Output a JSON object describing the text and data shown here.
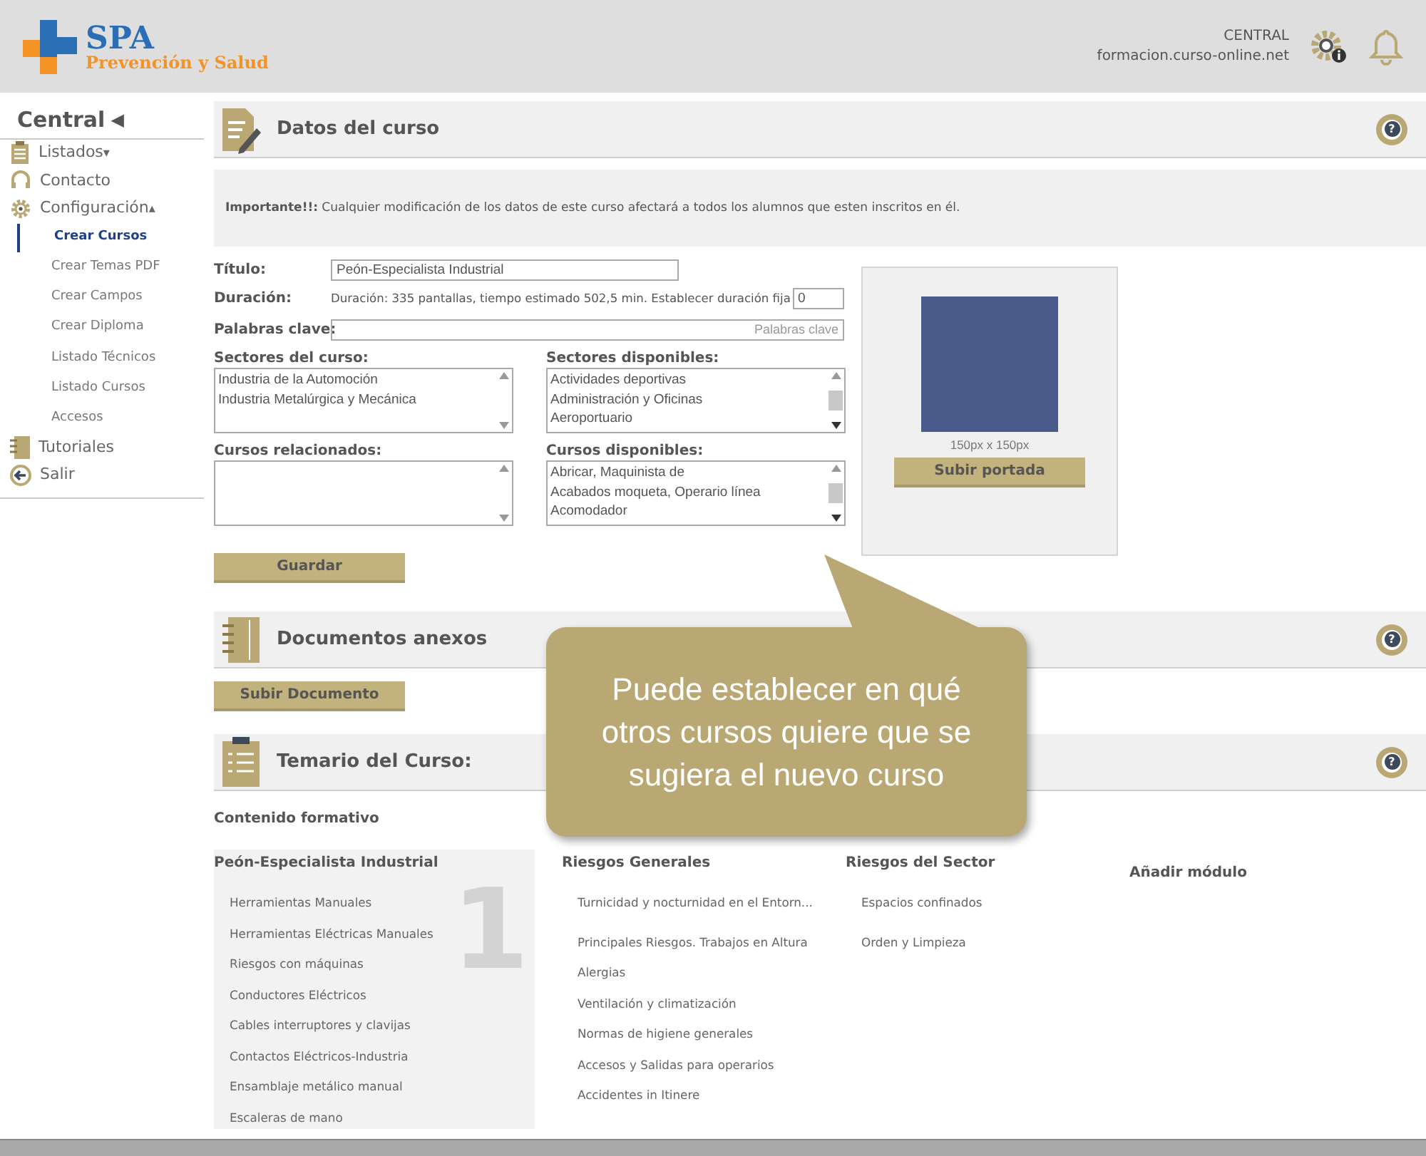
{
  "header": {
    "logo_title": "SPA",
    "logo_subtitle": "Prevención y Salud",
    "center": "CENTRAL",
    "domain": "formacion.curso-online.net"
  },
  "sidebar": {
    "title": "Central",
    "title_caret": "◀",
    "items": [
      {
        "label": "Listados",
        "caret": "▾"
      },
      {
        "label": "Contacto"
      },
      {
        "label": "Configuración",
        "caret": "▴",
        "children": [
          {
            "label": "Crear Cursos",
            "selected": true
          },
          {
            "label": "Crear Temas PDF",
            "selected": false
          },
          {
            "label": "Crear Campos",
            "selected": false
          },
          {
            "label": "Crear Diploma",
            "selected": false
          },
          {
            "label": "Listado Técnicos",
            "selected": false
          },
          {
            "label": "Listado Cursos",
            "selected": false
          },
          {
            "label": "Accesos",
            "selected": false
          }
        ]
      },
      {
        "label": "Tutoriales"
      },
      {
        "label": "Salir"
      }
    ]
  },
  "datos": {
    "title": "Datos del curso",
    "help": "?",
    "notice_bold": "Importante!!:",
    "notice": "Cualquier modificación de los datos de este curso afectará a todos los alumnos que esten inscritos en él.",
    "titulo_label": "Título:",
    "titulo_value": "Peón-Especialista Industrial",
    "duracion_label": "Duración:",
    "duracion_text": "Duración: 335 pantallas, tiempo estimado 502,5 min. Establecer duración fija",
    "duracion_value": "0",
    "keywords_label": "Palabras clave:",
    "keywords_placeholder": "Palabras clave",
    "lists": [
      {
        "label": "Sectores del curso:",
        "items": [
          "Industria de la Automoción",
          "Industria Metalúrgica y Mecánica"
        ]
      },
      {
        "label": "Sectores disponibles:",
        "items": [
          "Actividades deportivas",
          "Administración y Oficinas",
          "Aeroportuario"
        ]
      },
      {
        "label": "Cursos relacionados:"
      },
      {
        "label": "Cursos disponibles:",
        "items": [
          "Abricar, Maquinista de",
          "Acabados moqueta, Operario línea",
          "Acomodador"
        ]
      }
    ],
    "cover_size": "150px x 150px",
    "cover_button": "Subir portada",
    "save_button": "Guardar"
  },
  "documentos": {
    "title": "Documentos anexos",
    "help": "?",
    "button": "Subir Documento"
  },
  "temario": {
    "title": "Temario del Curso:",
    "help": "?",
    "subtitle": "Contenido formativo",
    "modules": [
      {
        "kind": "module",
        "title": "Peón-Especialista Industrial",
        "number": "1",
        "selected": true,
        "items": [
          "Herramientas Manuales",
          "Herramientas Eléctricas Manuales",
          "Riesgos con máquinas",
          "Conductores Eléctricos",
          "Cables interruptores y clavijas",
          "Contactos Eléctricos-Industria",
          "Ensamblaje metálico manual",
          "Escaleras de mano"
        ]
      },
      {
        "kind": "module",
        "title": "Riesgos Generales",
        "selected": false,
        "items": [
          "Turnicidad y nocturnidad en el Entorn...",
          "Principales Riesgos. Trabajos en Altura",
          "Alergias",
          "Ventilación y climatización",
          "Normas de higiene generales",
          "Accesos y Salidas para operarios",
          "Accidentes in Itinere"
        ]
      },
      {
        "kind": "module",
        "title": "Riesgos del Sector",
        "selected": false,
        "items": [
          "Espacios confinados",
          "Orden y Limpieza"
        ]
      },
      {
        "kind": "add",
        "title": "Añadir módulo"
      }
    ]
  },
  "callout": {
    "text": "Puede establecer en qué otros cursos quiere que se sugiera el nuevo curso"
  }
}
